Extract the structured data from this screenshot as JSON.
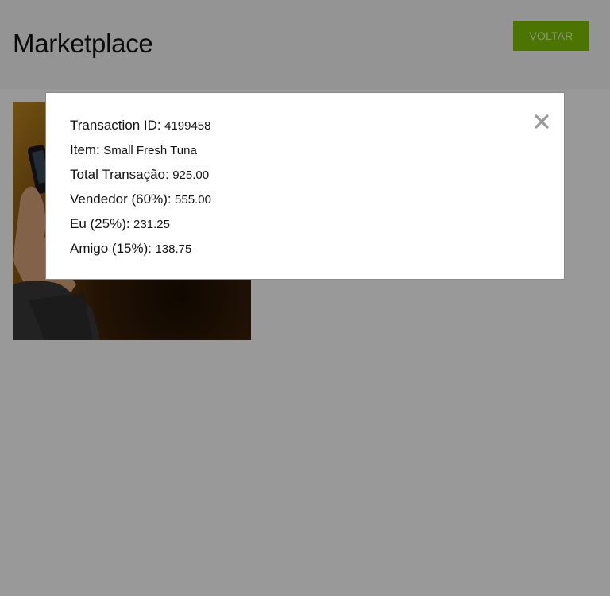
{
  "header": {
    "title": "Marketplace",
    "back_label": "VOLTAR"
  },
  "colors": {
    "accent": "#7dc400",
    "overlay": "#999999"
  },
  "product": {
    "image_icon": "phone-photo"
  },
  "modal": {
    "close_icon": "close-icon",
    "rows": [
      {
        "label": "Transaction ID:",
        "value": "4199458"
      },
      {
        "label": "Item:",
        "value": "Small Fresh Tuna"
      },
      {
        "label": "Total Transação:",
        "value": "925.00"
      },
      {
        "label": "Vendedor (60%):",
        "value": "555.00"
      },
      {
        "label": "Eu (25%):",
        "value": "231.25"
      },
      {
        "label": "Amigo (15%):",
        "value": "138.75"
      }
    ]
  }
}
